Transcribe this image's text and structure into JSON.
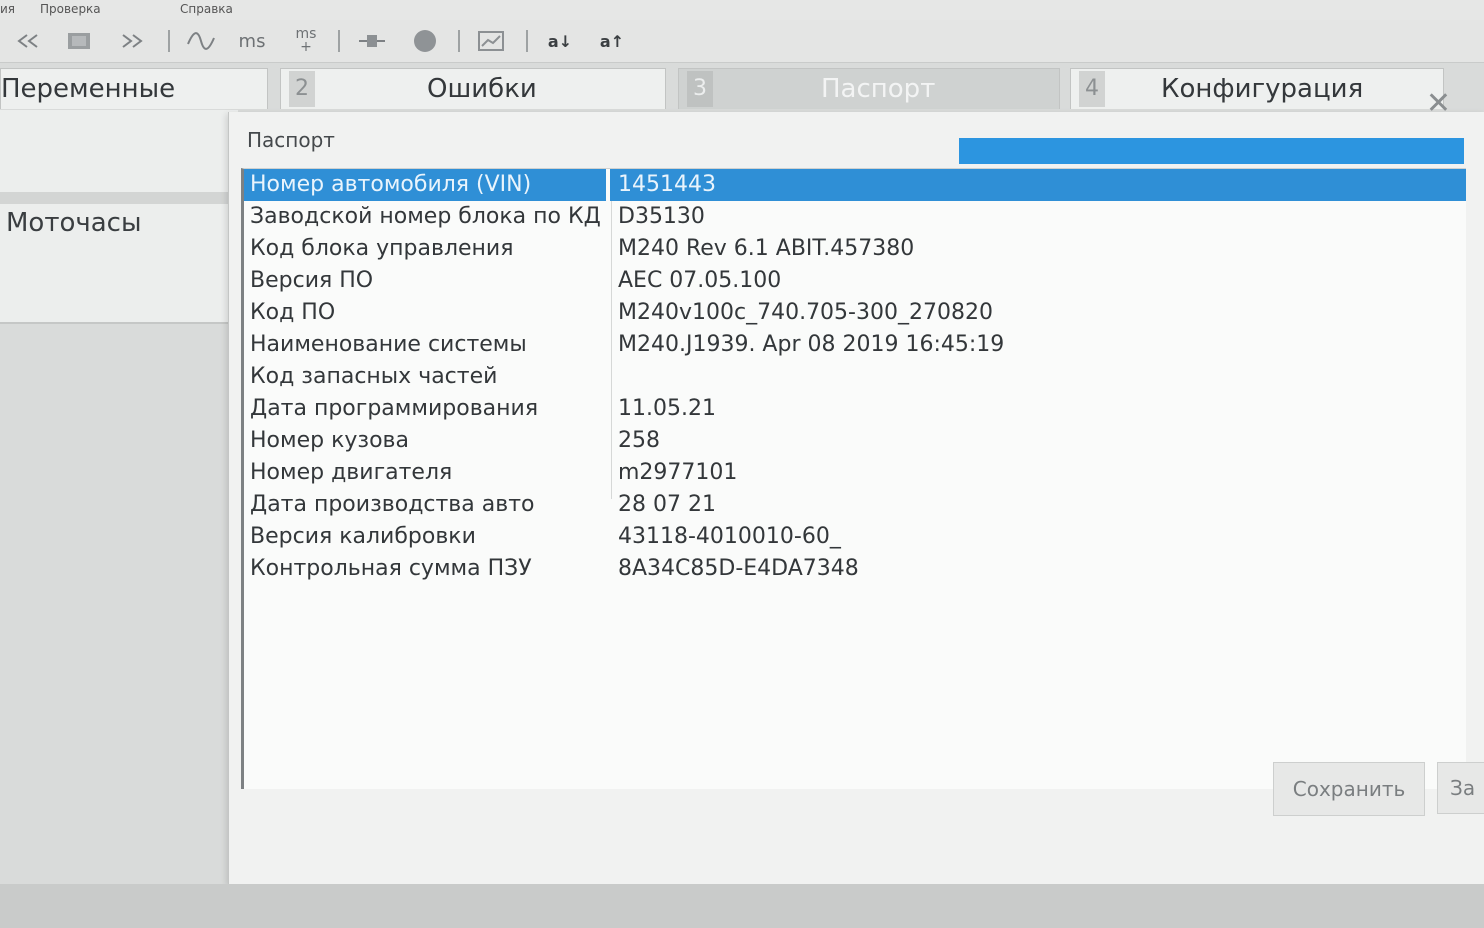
{
  "menubar": {
    "items": [
      "ия",
      "Проверка",
      "Справка"
    ]
  },
  "toolbar": {
    "icons": [
      "rewind-icon",
      "stop-icon",
      "forward-icon",
      "wave-icon",
      "ms-icon",
      "ms-plus-icon",
      "pin-icon",
      "record-icon",
      "chart-icon",
      "sort-down-icon",
      "sort-up-icon"
    ],
    "ms_label": "ms",
    "ms_plus_label": "ms",
    "sort_down_label": "a↓",
    "sort_up_label": "a↑"
  },
  "tabs": [
    {
      "num": "",
      "label": "Переменные"
    },
    {
      "num": "2",
      "label": "Ошибки"
    },
    {
      "num": "3",
      "label": "Паспорт",
      "active": true
    },
    {
      "num": "4",
      "label": "Конфигурация"
    }
  ],
  "left_panel": {
    "items": [
      "Моточасы"
    ]
  },
  "dialog": {
    "title": "Паспорт",
    "close": "✕",
    "rows": [
      {
        "key": "Номер автомобиля (VIN)",
        "value": "1451443",
        "selected": true
      },
      {
        "key": "Заводской номер блока по КД",
        "value": "D35130"
      },
      {
        "key": "Код блока управления",
        "value": "M240 Rev 6.1 ABIT.457380"
      },
      {
        "key": "Версия ПО",
        "value": "AEC 07.05.100"
      },
      {
        "key": "Код ПО",
        "value": "M240v100c_740.705-300_270820"
      },
      {
        "key": "Наименование системы",
        "value": "M240.J1939. Apr 08 2019 16:45:19"
      },
      {
        "key": "Код запасных частей",
        "value": ""
      },
      {
        "key": "Дата программирования",
        "value": "11.05.21"
      },
      {
        "key": "Номер кузова",
        "value": "258"
      },
      {
        "key": "Номер двигателя",
        "value": "m2977101"
      },
      {
        "key": "Дата производства авто",
        "value": "28 07 21"
      },
      {
        "key": "Версия калибровки",
        "value": "43118-4010010-60_"
      },
      {
        "key": "Контрольная сумма ПЗУ",
        "value": "8A34C85D-E4DA7348"
      }
    ],
    "buttons": {
      "save": "Сохранить",
      "next": "За"
    }
  },
  "colors": {
    "selection": "#2f8fd6",
    "window_bg": "#f1f2f1",
    "tab_bg": "#eef0ef"
  }
}
